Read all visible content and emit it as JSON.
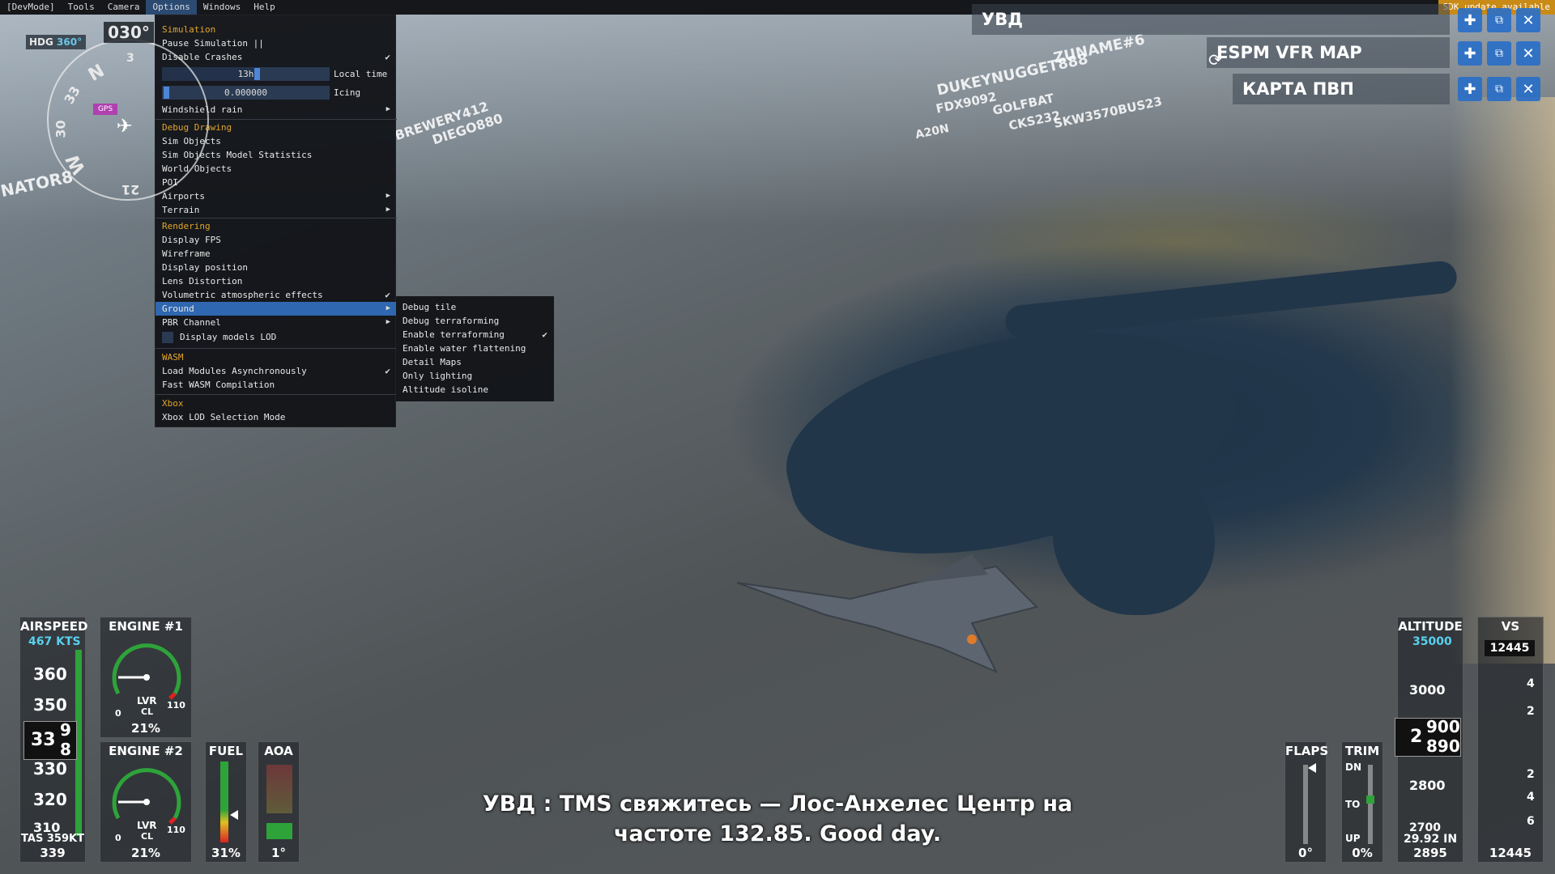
{
  "menubar": {
    "items": [
      "[DevMode]",
      "Tools",
      "Camera",
      "Options",
      "Windows",
      "Help"
    ],
    "active": "Options",
    "sdk_notice": "SDK update available"
  },
  "dropdown": {
    "sim_header": "Simulation",
    "pause": "Pause Simulation ||",
    "disable_crashes": "Disable Crashes",
    "time_value": "13h",
    "time_label": "Local time",
    "icing_value": "0.000000",
    "icing_label": "Icing",
    "windshield_rain": "Windshield rain",
    "debug_header": "Debug Drawing",
    "sim_objects": "Sim Objects",
    "sim_objects_stats": "Sim Objects Model Statistics",
    "world_objects": "World Objects",
    "poi": "POI",
    "airports": "Airports",
    "terrain": "Terrain",
    "rendering_header": "Rendering",
    "display_fps": "Display FPS",
    "wireframe": "Wireframe",
    "display_position": "Display position",
    "lens_distortion": "Lens Distortion",
    "volumetric": "Volumetric atmospheric effects",
    "ground": "Ground",
    "pbr_channel": "PBR Channel",
    "display_models_lod": "Display models LOD",
    "wasm_header": "WASM",
    "load_modules": "Load Modules Asynchronously",
    "fast_wasm": "Fast WASM Compilation",
    "xbox_header": "Xbox",
    "xbox_lod": "Xbox LOD Selection Mode"
  },
  "submenu": {
    "items": [
      "Debug tile",
      "Debug terraforming",
      "Enable terraforming",
      "Enable water flattening",
      "Detail Maps",
      "Only lighting",
      "Altitude isoline"
    ],
    "checked": "Enable terraforming"
  },
  "panels": {
    "top_partial": "УВД",
    "vfr_map": "ESPM VFR MAP",
    "karta": "КАРТА ПВП"
  },
  "compass": {
    "hdg_label": "HDG",
    "hdg_bug": "360°",
    "heading": "030°",
    "gps": "GPS",
    "labels": [
      "N",
      "33",
      "30",
      "W",
      "3",
      "21"
    ]
  },
  "airspeed": {
    "title": "AIRSPEED",
    "selected": "467 KTS",
    "ticks": [
      "360",
      "350",
      "330",
      "320",
      "310"
    ],
    "current_a": "33",
    "current_b": "9",
    "current_c": "8",
    "tas": "TAS 359KT",
    "value": "339"
  },
  "engine1": {
    "title": "ENGINE #1",
    "mode": "LVR",
    "mode2": "CL",
    "min": "0",
    "max": "110",
    "percent": "21%"
  },
  "engine2": {
    "title": "ENGINE #2",
    "mode": "LVR",
    "mode2": "CL",
    "min": "0",
    "max": "110",
    "percent": "21%"
  },
  "fuel": {
    "title": "FUEL",
    "value": "31%"
  },
  "aoa": {
    "title": "AOA",
    "value": "1°"
  },
  "flaps": {
    "title": "FLAPS",
    "value": "0°"
  },
  "trim": {
    "title": "TRIM",
    "dn": "DN",
    "to": "TO",
    "up": "UP",
    "value": "0%"
  },
  "altitude": {
    "title": "ALTITUDE",
    "selected": "35000",
    "ticks": [
      "3000",
      "2800",
      "2700"
    ],
    "current_a": "2",
    "current_b": "900",
    "current_c": "890",
    "baro": "29.92 IN",
    "value": "2895"
  },
  "vs": {
    "title": "VS",
    "top": "12445",
    "ticks": [
      "4",
      "2",
      "2",
      "4",
      "6"
    ],
    "value": "12445"
  },
  "traffic_tags": [
    "DUKEYNUGGET888",
    "ZUNAME#6",
    "FDX9092",
    "GOLFBAT",
    "A20N",
    "CKS232",
    "SKW3570BUS23",
    "BREWERY412",
    "DIEGO880",
    "NATOR8"
  ],
  "subtitle": {
    "line1": "УВД : TMS свяжитесь — Лос-Анхелес Центр на",
    "line2": "частоте 132.85. Good day."
  }
}
